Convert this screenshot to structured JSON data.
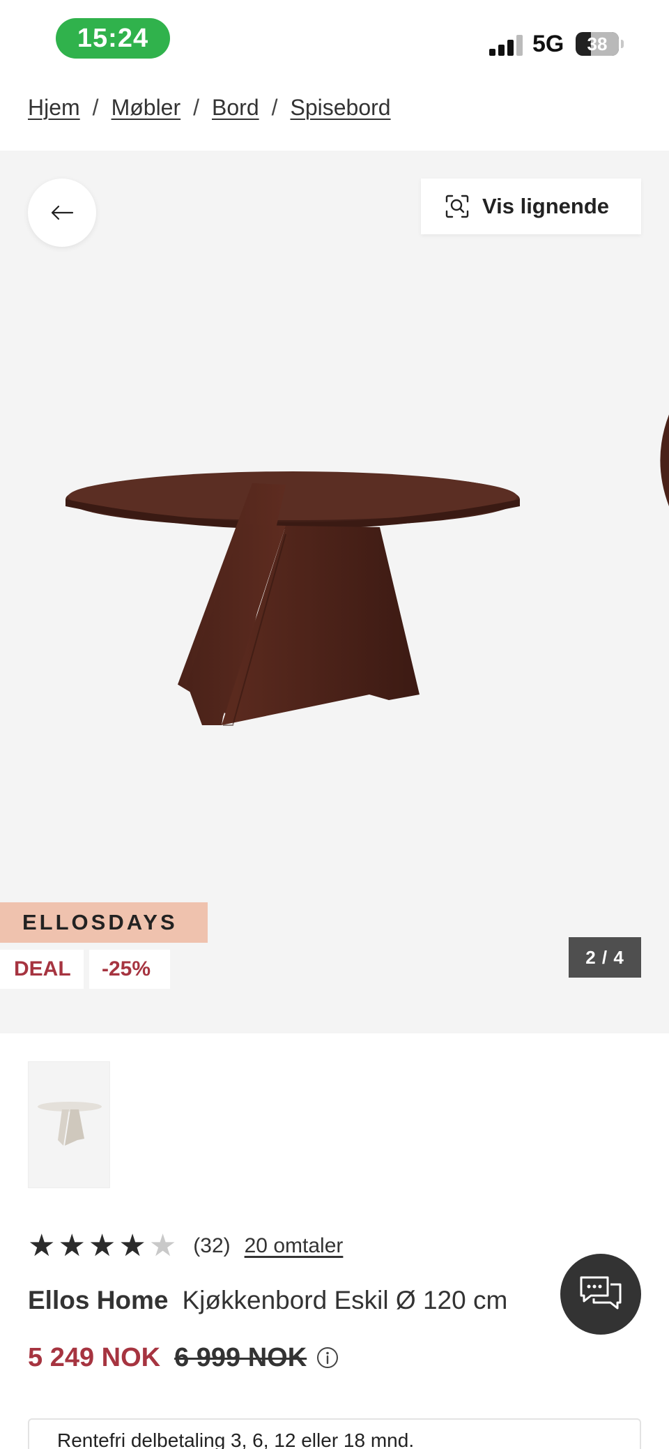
{
  "status_bar": {
    "time": "15:24",
    "network": "5G",
    "battery": "38"
  },
  "breadcrumb": {
    "items": [
      "Hjem",
      "Møbler",
      "Bord",
      "Spisebord"
    ],
    "separator": "/"
  },
  "gallery": {
    "similar_label": "Vis lignende",
    "promo_label": "ELLOSDAYS",
    "deal_label": "DEAL",
    "discount_label": "-25%",
    "counter": "2 / 4",
    "image_progress": {
      "current": 2,
      "total": 4
    }
  },
  "rating": {
    "stars": 4,
    "max_stars": 5,
    "count": "(32)",
    "reviews_link": "20 omtaler"
  },
  "product": {
    "brand": "Ellos Home",
    "name": "Kjøkkenbord Eskil Ø 120 cm"
  },
  "price": {
    "current": "5 249 NOK",
    "original": "6 999 NOK"
  },
  "installment": {
    "text": "Rentefri delbetaling 3, 6, 12 eller 18 mnd."
  },
  "colors": {
    "price_accent": "#a63440",
    "promo_bg": "#efc2ae",
    "status_green": "#30b24c",
    "gallery_bg": "#f4f4f4"
  },
  "icons": {
    "back": "arrow-left-icon",
    "similar": "visual-search-icon",
    "info": "info-icon",
    "chat": "chat-bubbles-icon"
  }
}
